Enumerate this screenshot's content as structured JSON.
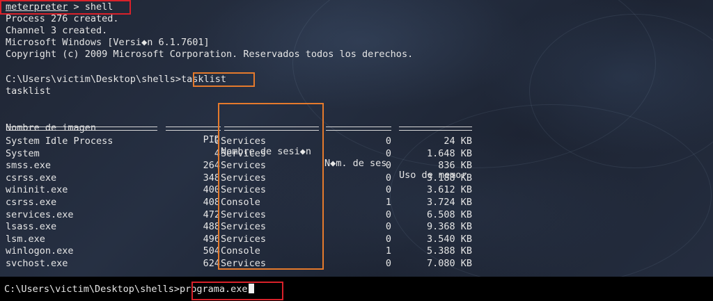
{
  "terminal": {
    "header_lines": [
      {
        "prompt": "meterpreter",
        "sep": " > ",
        "cmd": "shell"
      },
      "Process 276 created.",
      "Channel 3 created.",
      "Microsoft Windows [Versi◆n 6.1.7601]",
      "Copyright (c) 2009 Microsoft Corporation. Reservados todos los derechos."
    ],
    "prompt_path": "C:\\Users\\victim\\Desktop\\shells>",
    "tasklist_cmd": "tasklist",
    "tasklist_echo": "tasklist",
    "table": {
      "headers": [
        "Nombre de imagen",
        "PID",
        "Nombre de sesi◆n",
        "N◆m. de ses",
        "Uso de memor"
      ],
      "rows": [
        [
          "System Idle Process",
          "0",
          "Services",
          "0",
          "24 KB"
        ],
        [
          "System",
          "4",
          "Services",
          "0",
          "1.648 KB"
        ],
        [
          "smss.exe",
          "264",
          "Services",
          "0",
          "836 KB"
        ],
        [
          "csrss.exe",
          "348",
          "Services",
          "0",
          "3.188 KB"
        ],
        [
          "wininit.exe",
          "400",
          "Services",
          "0",
          "3.612 KB"
        ],
        [
          "csrss.exe",
          "408",
          "Console",
          "1",
          "3.724 KB"
        ],
        [
          "services.exe",
          "472",
          "Services",
          "0",
          "6.508 KB"
        ],
        [
          "lsass.exe",
          "488",
          "Services",
          "0",
          "9.368 KB"
        ],
        [
          "lsm.exe",
          "496",
          "Services",
          "0",
          "3.540 KB"
        ],
        [
          "winlogon.exe",
          "504",
          "Console",
          "1",
          "5.388 KB"
        ],
        [
          "svchost.exe",
          "624",
          "Services",
          "0",
          "7.080 KB"
        ]
      ]
    }
  },
  "bottom": {
    "prompt_path": "C:\\Users\\victim\\Desktop\\shells>",
    "command": "programa.exe"
  },
  "colors": {
    "highlight_red": "#d9212a",
    "highlight_orange": "#e57a2c",
    "text": "#e6e6e6",
    "bottom_bar": "#000000"
  }
}
